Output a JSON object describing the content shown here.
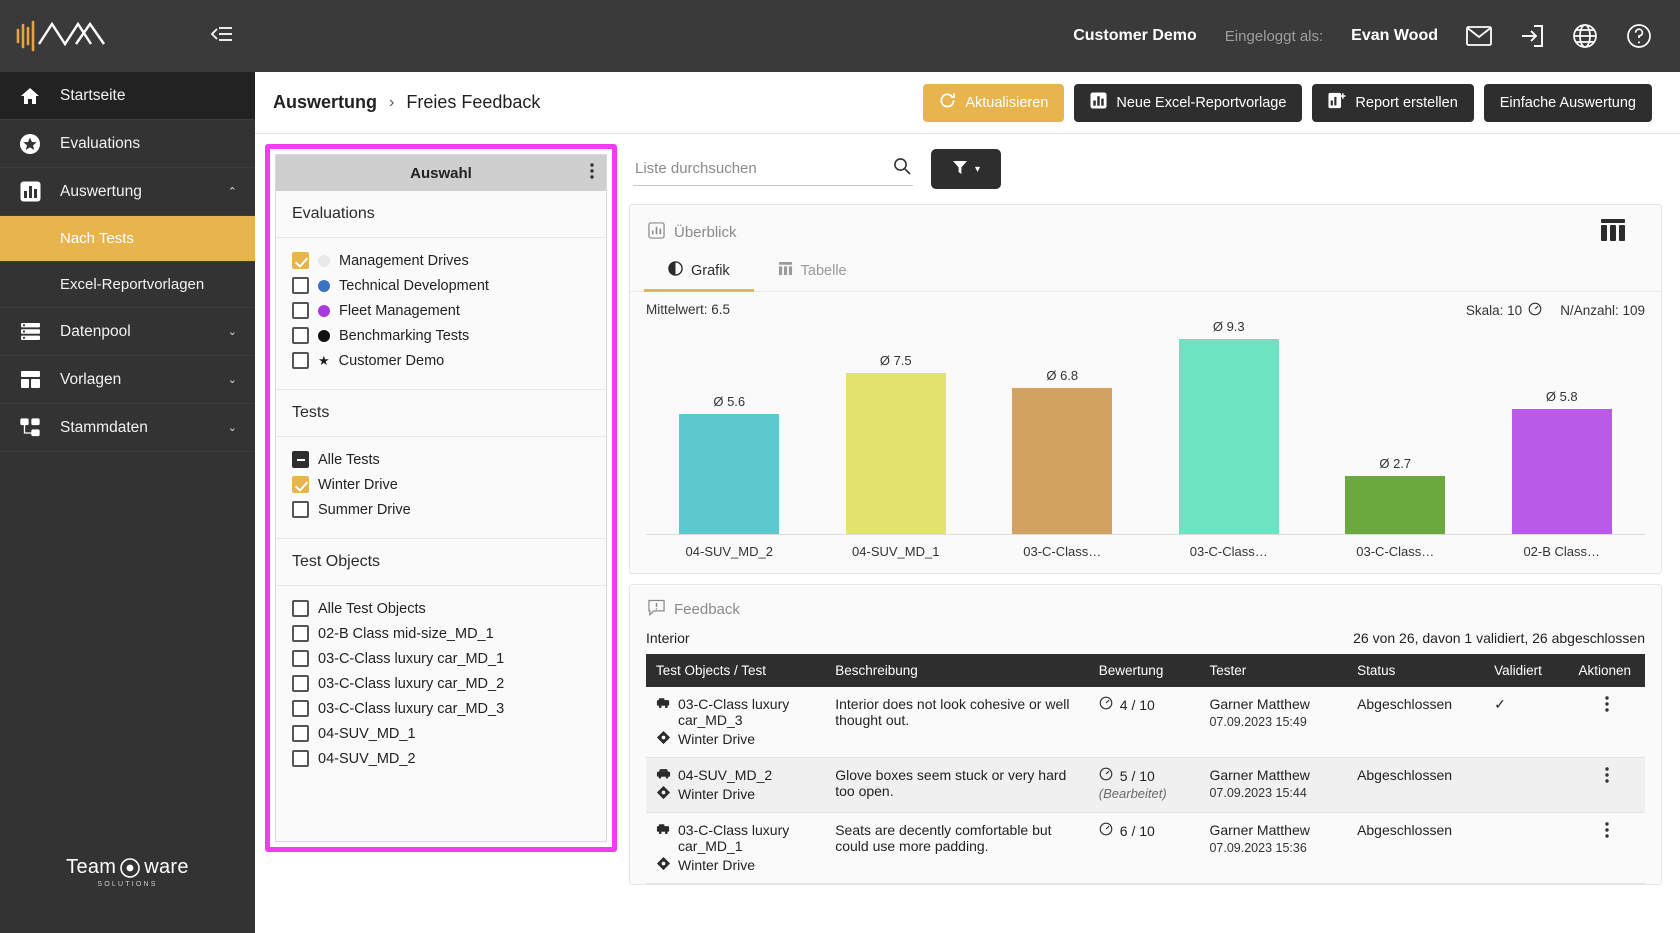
{
  "sidebar": {
    "collapse_icon": "collapse-sidebar-icon",
    "items": [
      {
        "label": "Startseite",
        "icon": "home-icon",
        "state": "active-dark",
        "chevron": ""
      },
      {
        "label": "Evaluations",
        "icon": "star-badge-icon",
        "state": "",
        "chevron": ""
      },
      {
        "label": "Auswertung",
        "icon": "bar-chart-icon",
        "state": "",
        "chevron": "⌃"
      },
      {
        "label": "Datenpool",
        "icon": "database-list-icon",
        "state": "",
        "chevron": "⌄"
      },
      {
        "label": "Vorlagen",
        "icon": "templates-icon",
        "state": "",
        "chevron": "⌄"
      },
      {
        "label": "Stammdaten",
        "icon": "hierarchy-icon",
        "state": "",
        "chevron": "⌄"
      }
    ],
    "subitems": [
      {
        "label": "Nach Tests",
        "selected": true
      },
      {
        "label": "Excel-Reportvorlagen",
        "selected": false
      }
    ],
    "footer": {
      "brand_left": "Team",
      "brand_right": "ware",
      "brand_sub": "SOLUTIONS"
    }
  },
  "topbar": {
    "customer": "Customer Demo",
    "logged_in_label": "Eingeloggt als:",
    "user": "Evan Wood",
    "icons": [
      "mail-icon",
      "logout-icon",
      "globe-icon",
      "help-icon"
    ]
  },
  "breadcrumb": {
    "parent": "Auswertung",
    "separator": "›",
    "current": "Freies Feedback"
  },
  "actions": {
    "refresh": "Aktualisieren",
    "new_excel_template": "Neue Excel-Reportvorlage",
    "create_report": "Report erstellen",
    "simple_evaluation": "Einfache Auswertung"
  },
  "selection": {
    "header": "Auswahl",
    "kebab_icon": "more-vertical-icon",
    "sections": [
      {
        "title": "Evaluations",
        "options": [
          {
            "label": "Management Drives",
            "checked": true,
            "marker": "dot",
            "color": "#e8e8e8"
          },
          {
            "label": "Technical Development",
            "checked": false,
            "marker": "dot",
            "color": "#3a72c4"
          },
          {
            "label": "Fleet Management",
            "checked": false,
            "marker": "dot",
            "color": "#a93ae0"
          },
          {
            "label": "Benchmarking Tests",
            "checked": false,
            "marker": "dot",
            "color": "#121212"
          },
          {
            "label": "Customer Demo",
            "checked": false,
            "marker": "star",
            "color": "#121212"
          }
        ]
      },
      {
        "title": "Tests",
        "options": [
          {
            "label": "Alle Tests",
            "checked": "indeterminate",
            "marker": "none",
            "color": ""
          },
          {
            "label": "Winter Drive",
            "checked": true,
            "marker": "none",
            "color": ""
          },
          {
            "label": "Summer Drive",
            "checked": false,
            "marker": "none",
            "color": ""
          }
        ]
      },
      {
        "title": "Test Objects",
        "options": [
          {
            "label": "Alle Test Objects",
            "checked": false,
            "marker": "none",
            "color": ""
          },
          {
            "label": "02-B Class mid-size_MD_1",
            "checked": false,
            "marker": "none",
            "color": ""
          },
          {
            "label": "03-C-Class luxury car_MD_1",
            "checked": false,
            "marker": "none",
            "color": ""
          },
          {
            "label": "03-C-Class luxury car_MD_2",
            "checked": false,
            "marker": "none",
            "color": ""
          },
          {
            "label": "03-C-Class luxury car_MD_3",
            "checked": false,
            "marker": "none",
            "color": ""
          },
          {
            "label": "04-SUV_MD_1",
            "checked": false,
            "marker": "none",
            "color": ""
          },
          {
            "label": "04-SUV_MD_2",
            "checked": false,
            "marker": "none",
            "color": ""
          }
        ]
      }
    ]
  },
  "search": {
    "placeholder": "Liste durchsuchen",
    "value": "",
    "icon": "search-icon"
  },
  "filter_button": {
    "icon": "funnel-icon",
    "caret": "▾"
  },
  "overview": {
    "title": "Überblick",
    "icon": "bar-chart-icon",
    "grid_icon": "table-columns-icon",
    "tabs": [
      {
        "label": "Grafik",
        "icon": "pie-chart-icon",
        "active": true
      },
      {
        "label": "Tabelle",
        "icon": "table-icon",
        "active": false
      }
    ],
    "mean_label": "Mittelwert: 6.5",
    "scale_label": "Skala: 10",
    "scale_icon": "gauge-icon",
    "count_label": "N/Anzahl: 109"
  },
  "chart_data": {
    "type": "bar",
    "title": "Überblick",
    "categories": [
      "04-SUV_MD_2",
      "04-SUV_MD_1",
      "03-C-Class…",
      "03-C-Class…",
      "03-C-Class…",
      "02-B Class…"
    ],
    "values": [
      5.6,
      7.5,
      6.8,
      9.3,
      2.7,
      5.8
    ],
    "data_labels": [
      "Ø 5.6",
      "Ø 7.5",
      "Ø 6.8",
      "Ø 9.3",
      "Ø 2.7",
      "Ø 5.8"
    ],
    "colors": [
      "#5ec8cf",
      "#e2e26e",
      "#d2a261",
      "#6ee3c2",
      "#6ba840",
      "#b95ae8"
    ],
    "ylim": [
      0,
      10
    ],
    "ylabel": "",
    "xlabel": "",
    "grid": false,
    "legend": "none",
    "mean": 6.5,
    "scale": 10,
    "n": 109
  },
  "feedback": {
    "title": "Feedback",
    "icon": "feedback-icon",
    "group": "Interior",
    "summary": "26 von 26, davon 1 validiert, 26 abgeschlossen",
    "columns": [
      "Test Objects / Test",
      "Beschreibung",
      "Bewertung",
      "Tester",
      "Status",
      "Validiert",
      "Aktionen"
    ],
    "rows": [
      {
        "object": "03-C-Class luxury car_MD_3",
        "object_icon": "car-side-icon",
        "test": "Winter Drive",
        "test_icon": "diamond-icon",
        "description": "Interior does not look cohesive or well thought out.",
        "rating": "4 / 10",
        "rating_icon": "gauge-icon",
        "edited": "",
        "tester": "Garner Matthew",
        "timestamp": "07.09.2023 15:49",
        "status": "Abgeschlossen",
        "validated": "✓",
        "actions_icon": "more-vertical-icon"
      },
      {
        "object": "04-SUV_MD_2",
        "object_icon": "car-front-icon",
        "test": "Winter Drive",
        "test_icon": "diamond-icon",
        "description": "Glove boxes seem stuck or very hard too open.",
        "rating": "5 / 10",
        "rating_icon": "gauge-icon",
        "edited": "(Bearbeitet)",
        "tester": "Garner Matthew",
        "timestamp": "07.09.2023 15:44",
        "status": "Abgeschlossen",
        "validated": "",
        "actions_icon": "more-vertical-icon"
      },
      {
        "object": "03-C-Class luxury car_MD_1",
        "object_icon": "car-side-icon",
        "test": "Winter Drive",
        "test_icon": "diamond-icon",
        "description": "Seats are decently comfortable but could use more padding.",
        "rating": "6 / 10",
        "rating_icon": "gauge-icon",
        "edited": "",
        "tester": "Garner Matthew",
        "timestamp": "07.09.2023 15:36",
        "status": "Abgeschlossen",
        "validated": "",
        "actions_icon": "more-vertical-icon"
      }
    ]
  }
}
